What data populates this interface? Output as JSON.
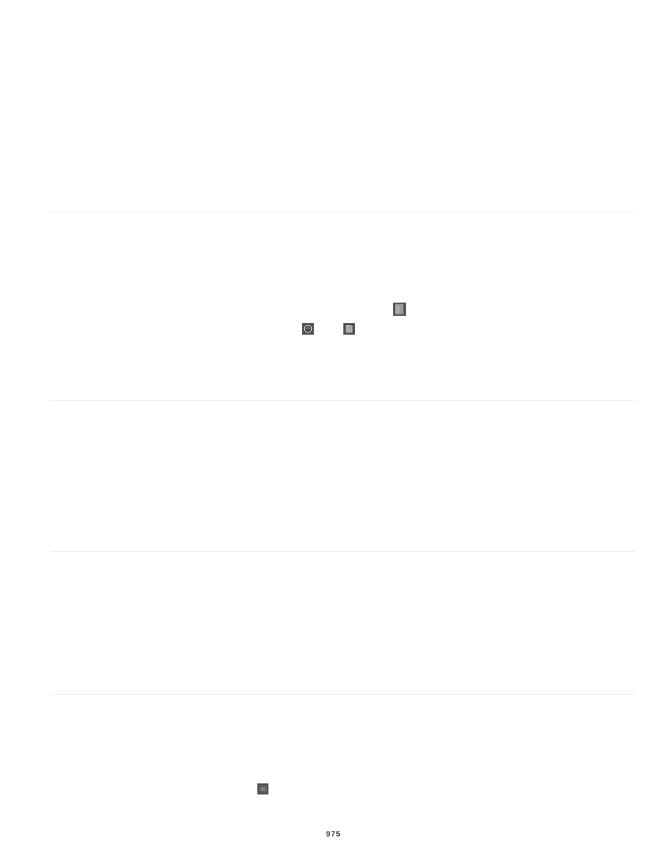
{
  "page_number": "975",
  "rules": [
    {
      "position": "hr1"
    },
    {
      "position": "hr2"
    },
    {
      "position": "hr3"
    },
    {
      "position": "hr4"
    }
  ],
  "icons": [
    {
      "name": "book-icon",
      "class": "icon1"
    },
    {
      "name": "circle-icon",
      "class": "icon2"
    },
    {
      "name": "paper-icon",
      "class": "icon3"
    },
    {
      "name": "list-icon",
      "class": "icon4"
    }
  ]
}
